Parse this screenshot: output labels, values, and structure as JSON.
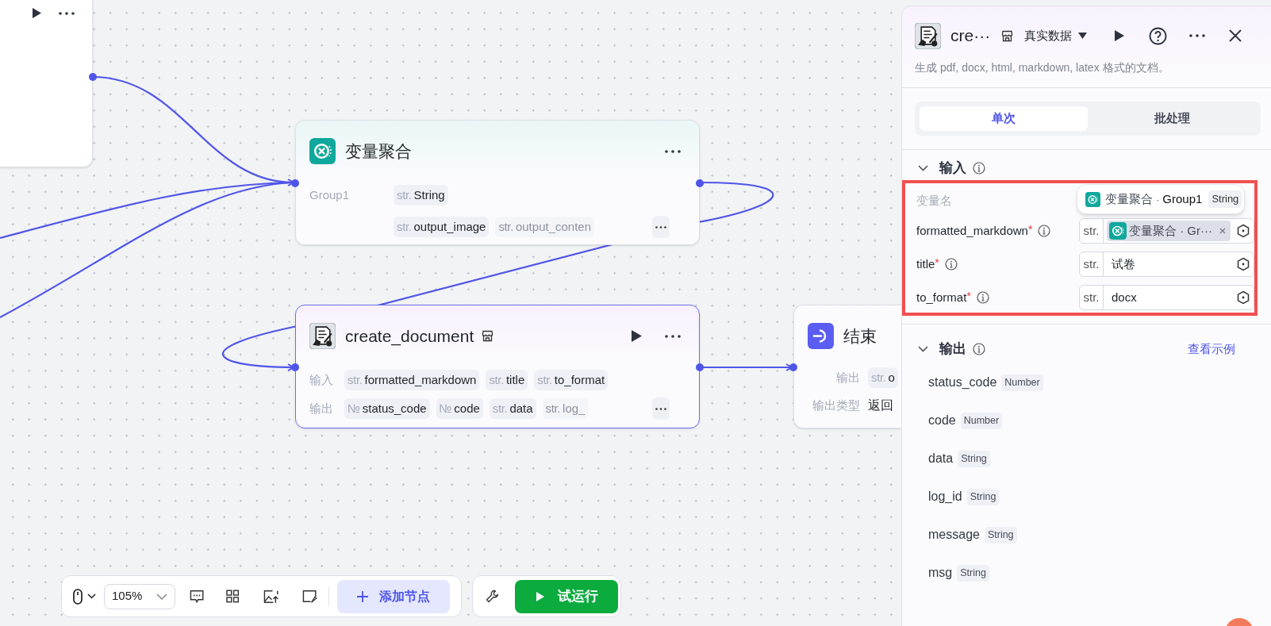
{
  "canvas": {
    "aggregate_node": {
      "title": "变量聚合",
      "group_label": "Group1",
      "group_tags": [
        {
          "prefix": "str.",
          "name": "String",
          "faded": false
        }
      ],
      "variable_tags": [
        {
          "prefix": "str.",
          "name": "output_image",
          "faded": false
        },
        {
          "prefix": "str.",
          "name": "output_conten",
          "faded": true
        }
      ]
    },
    "document_node": {
      "title": "create_document",
      "selected": true,
      "input_label": "输入",
      "inputs": [
        {
          "prefix": "str.",
          "name": "formatted_markdown",
          "faded": false
        },
        {
          "prefix": "str.",
          "name": "title",
          "faded": false
        },
        {
          "prefix": "str.",
          "name": "to_format",
          "faded": false
        }
      ],
      "output_label": "输出",
      "outputs": [
        {
          "prefix": "№",
          "name": "status_code",
          "faded": false
        },
        {
          "prefix": "№",
          "name": "code",
          "faded": false
        },
        {
          "prefix": "str.",
          "name": "data",
          "faded": false
        },
        {
          "prefix": "str.",
          "name": "log_",
          "faded": true
        }
      ]
    },
    "end_node": {
      "title": "结束",
      "output_label": "输出",
      "output_tag": {
        "prefix": "str.",
        "name": "o"
      },
      "type_label": "输出类型",
      "type_value": "返回"
    }
  },
  "toolbar": {
    "zoom": "105%",
    "add_node": "添加节点",
    "run": "试运行"
  },
  "panel": {
    "title": "cre···",
    "data_mode": "真实数据",
    "description": "生成 pdf, docx, html, markdown, latex 格式的文档。",
    "tabs": [
      {
        "label": "单次",
        "selected": true
      },
      {
        "label": "批处理",
        "selected": false
      }
    ],
    "input_section": {
      "title": "输入",
      "header": "变量名",
      "tooltip": {
        "node": "变量聚合",
        "separator": "·",
        "variable": "Group1",
        "type": "String"
      },
      "fields": [
        {
          "name": "formatted_markdown",
          "required_mark": "*",
          "kind": "reference",
          "prefix": "str.",
          "value": "变量聚合 · Gr···"
        },
        {
          "name": "title",
          "required_mark": "*",
          "kind": "text",
          "prefix": "str.",
          "value": "试卷"
        },
        {
          "name": "to_format",
          "required_mark": "*",
          "kind": "text",
          "prefix": "str.",
          "value": "docx"
        }
      ]
    },
    "output_section": {
      "title": "输出",
      "link": "查看示例",
      "outputs": [
        {
          "name": "status_code",
          "type": "Number"
        },
        {
          "name": "code",
          "type": "Number"
        },
        {
          "name": "data",
          "type": "String"
        },
        {
          "name": "log_id",
          "type": "String"
        },
        {
          "name": "message",
          "type": "String"
        },
        {
          "name": "msg",
          "type": "String"
        }
      ]
    }
  }
}
